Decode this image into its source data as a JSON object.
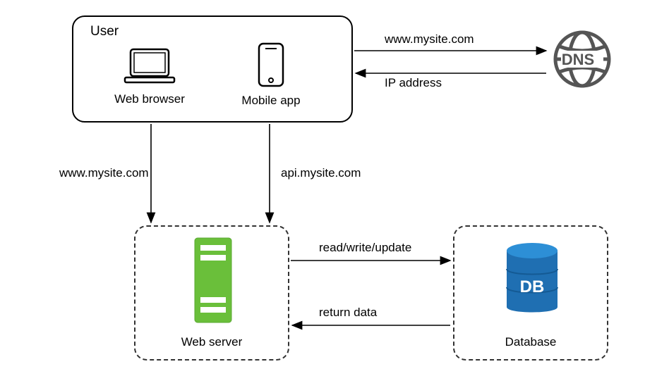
{
  "diagram": {
    "user_box_title": "User",
    "web_browser_label": "Web browser",
    "mobile_app_label": "Mobile app",
    "dns_label": "DNS",
    "web_server_label": "Web server",
    "database_label": "Database",
    "db_text": "DB",
    "arrows": {
      "to_dns": "www.mysite.com",
      "from_dns": "IP address",
      "browser_down": "www.mysite.com",
      "mobile_down": "api.mysite.com",
      "server_to_db": "read/write/update",
      "db_to_server": "return data"
    }
  }
}
